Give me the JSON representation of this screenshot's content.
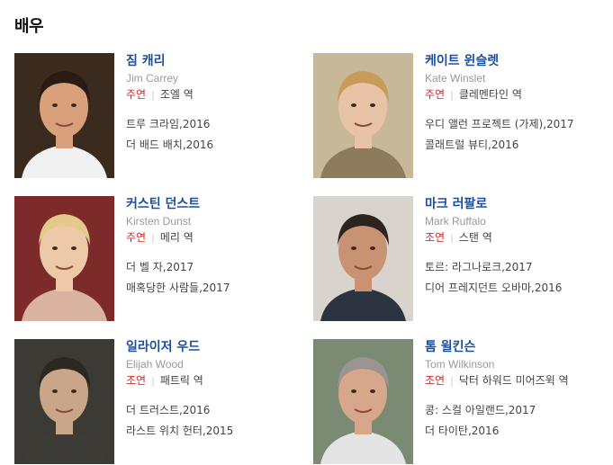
{
  "section": {
    "title": "배우"
  },
  "actors": [
    {
      "name": "짐 캐리",
      "name_en": "Jim Carrey",
      "role_type": "주연",
      "character": "조엘 역",
      "works": [
        "트루 크라임,2016",
        "더 배드 배치,2016"
      ],
      "bg": "#3b2a1e",
      "skin": "#d9a07c",
      "hair": "#2a1c14",
      "shirt": "#f1f1f1"
    },
    {
      "name": "케이트 윈슬렛",
      "name_en": "Kate Winslet",
      "role_type": "주연",
      "character": "클레멘타인 역",
      "works": [
        "우디 앨런 프로젝트 (가제),2017",
        "콜래트럴 뷰티,2016"
      ],
      "bg": "#c7b89a",
      "skin": "#e8c3a6",
      "hair": "#c79c5a",
      "shirt": "#8d7b5e"
    },
    {
      "name": "커스틴 던스트",
      "name_en": "Kirsten Dunst",
      "role_type": "주연",
      "character": "메리 역",
      "works": [
        "더 벨 자,2017",
        "매혹당한 사람들,2017"
      ],
      "bg": "#7d2a2a",
      "skin": "#edc9aa",
      "hair": "#e3c98a",
      "shirt": "#d9b2a0"
    },
    {
      "name": "마크 러팔로",
      "name_en": "Mark Ruffalo",
      "role_type": "조연",
      "character": "스탠 역",
      "works": [
        "토르: 라그나로크,2017",
        "디어 프레지던트 오바마,2016"
      ],
      "bg": "#d8d3cc",
      "skin": "#c99273",
      "hair": "#2b241f",
      "shirt": "#2c3440"
    },
    {
      "name": "일라이저 우드",
      "name_en": "Elijah Wood",
      "role_type": "조연",
      "character": "패트릭 역",
      "works": [
        "더 트러스트,2016",
        "라스트 위치 헌터,2015"
      ],
      "bg": "#3b3a35",
      "skin": "#c9a689",
      "hair": "#2e2620",
      "shirt": "#3d3b36"
    },
    {
      "name": "톰 윌킨슨",
      "name_en": "Tom Wilkinson",
      "role_type": "조연",
      "character": "닥터 하워드 미어즈윅 역",
      "works": [
        "콩: 스컬 아일랜드,2017",
        "더 타이탄,2016"
      ],
      "bg": "#7b8a73",
      "skin": "#d6a78a",
      "hair": "#9a9590",
      "shirt": "#e4e4e4"
    }
  ]
}
